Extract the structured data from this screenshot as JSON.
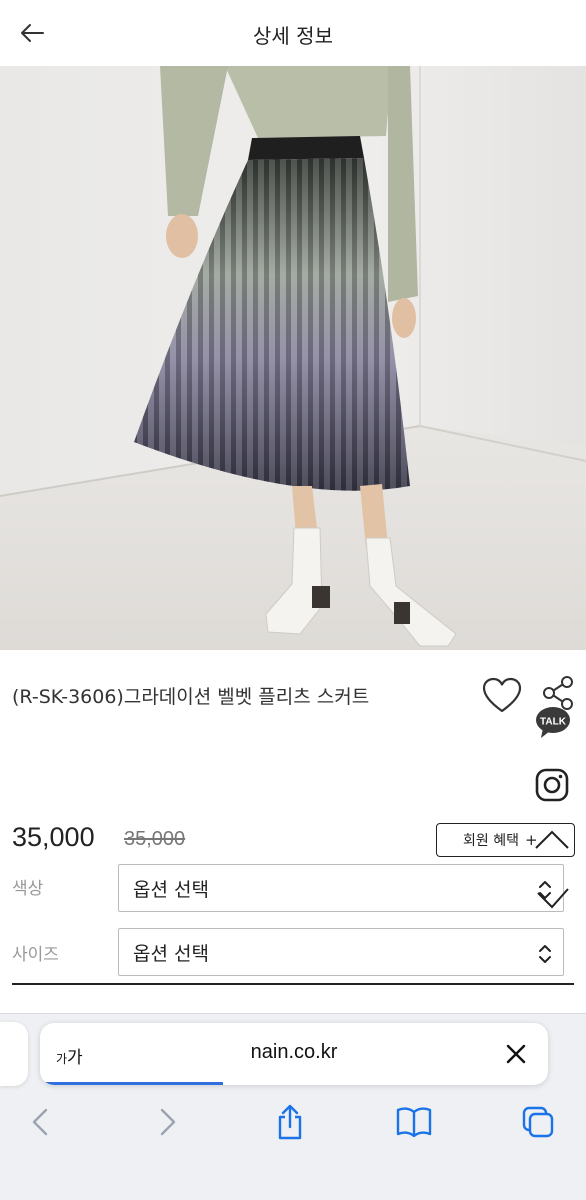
{
  "header": {
    "title": "상세 정보",
    "back_icon": "arrow-left-icon"
  },
  "product": {
    "name": "(R-SK-3606)그라데이션 벨벳 플리츠 스커트",
    "price": "35,000",
    "original_price": "35,000",
    "member_benefit_label": "회원 혜택",
    "member_benefit_plus": "+"
  },
  "options": {
    "color": {
      "label": "색상",
      "value": "옵션 선택"
    },
    "size": {
      "label": "사이즈",
      "value": "옵션 선택"
    }
  },
  "talk_badge": "TALK",
  "browser": {
    "aa_label_small": "가",
    "aa_label_large": "가",
    "url": "nain.co.kr",
    "load_progress": 0.36
  },
  "colors": {
    "accent_blue": "#2f6fe0",
    "kakao_dark": "#3a3a3a",
    "toolbar_blue": "#1a73e8"
  }
}
